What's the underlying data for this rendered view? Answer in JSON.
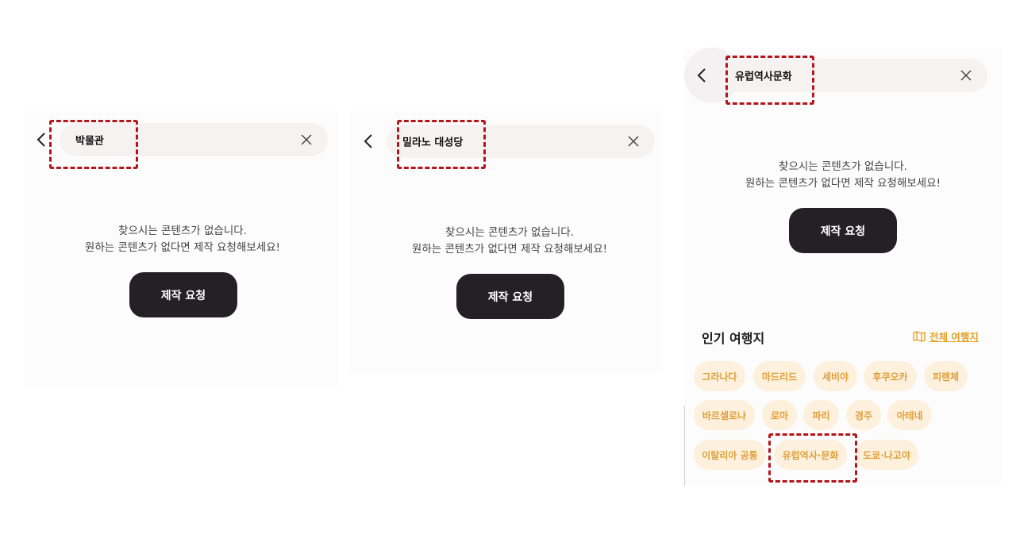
{
  "screen1": {
    "query": "박물관",
    "empty_line1": "찾으시는 콘텐츠가 없습니다.",
    "empty_line2": "원하는 콘텐츠가 없다면 제작 요청해보세요!",
    "request_button": "제작 요청"
  },
  "screen2": {
    "query": "밀라노 대성당",
    "empty_line1": "찾으시는 콘텐츠가 없습니다.",
    "empty_line2": "원하는 콘텐츠가 없다면 제작 요청해보세요!",
    "request_button": "제작 요청"
  },
  "screen3": {
    "query": "유럽역사문화",
    "empty_line1": "찾으시는 콘텐츠가 없습니다.",
    "empty_line2": "원하는 콘텐츠가 없다면 제작 요청해보세요!",
    "request_button": "제작 요청",
    "popular_title": "인기 여행지",
    "all_link": "전체 여행지",
    "chips": [
      "그라나다",
      "마드리드",
      "세비야",
      "후쿠오카",
      "피렌체",
      "바르셀로나",
      "로마",
      "파리",
      "경주",
      "아테네",
      "이탈리아 공통",
      "유럽역사·문화",
      "도쿄·나고야"
    ]
  },
  "colors": {
    "accent": "#e0a03a",
    "chip_bg": "#fdf0dd",
    "button_bg": "#232124",
    "search_bg": "#f6f2f2",
    "highlight_dash": "#b3151a"
  }
}
